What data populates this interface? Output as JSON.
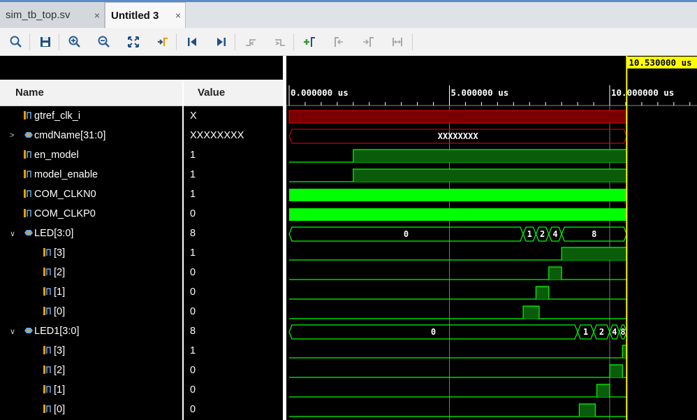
{
  "tabs": [
    {
      "label": "sim_tb_top.sv",
      "close": "×",
      "active": false
    },
    {
      "label": "Untitled 3",
      "close": "×",
      "active": true
    }
  ],
  "toolbar": [
    {
      "name": "search-icon"
    },
    {
      "name": "save-icon"
    },
    {
      "name": "zoom-in-icon"
    },
    {
      "name": "zoom-out-icon"
    },
    {
      "name": "zoom-fit-icon"
    },
    {
      "name": "go-to-cursor-icon"
    },
    {
      "name": "go-to-time-zero-icon"
    },
    {
      "name": "go-to-last-time-icon"
    },
    {
      "name": "previous-transition-icon"
    },
    {
      "name": "next-transition-icon"
    },
    {
      "name": "add-marker-icon"
    },
    {
      "name": "previous-marker-icon"
    },
    {
      "name": "next-marker-icon"
    },
    {
      "name": "swap-cursors-icon"
    }
  ],
  "columns": {
    "name": "Name",
    "value": "Value"
  },
  "signals": [
    {
      "name": "gtref_clk_i",
      "value": "X",
      "kind": "bit",
      "expander": "",
      "indent": 0
    },
    {
      "name": "cmdName[31:0]",
      "value": "XXXXXXXX",
      "kind": "bus",
      "expander": ">",
      "indent": 0
    },
    {
      "name": "en_model",
      "value": "1",
      "kind": "bit",
      "expander": "",
      "indent": 0
    },
    {
      "name": "model_enable",
      "value": "1",
      "kind": "bit",
      "expander": "",
      "indent": 0
    },
    {
      "name": "COM_CLKN0",
      "value": "1",
      "kind": "bit",
      "expander": "",
      "indent": 0
    },
    {
      "name": "COM_CLKP0",
      "value": "0",
      "kind": "bit",
      "expander": "",
      "indent": 0
    },
    {
      "name": "LED[3:0]",
      "value": "8",
      "kind": "bus",
      "expander": "∨",
      "indent": 0
    },
    {
      "name": "[3]",
      "value": "1",
      "kind": "bit",
      "expander": "",
      "indent": 1
    },
    {
      "name": "[2]",
      "value": "0",
      "kind": "bit",
      "expander": "",
      "indent": 1
    },
    {
      "name": "[1]",
      "value": "0",
      "kind": "bit",
      "expander": "",
      "indent": 1
    },
    {
      "name": "[0]",
      "value": "0",
      "kind": "bit",
      "expander": "",
      "indent": 1
    },
    {
      "name": "LED1[3:0]",
      "value": "8",
      "kind": "bus",
      "expander": "∨",
      "indent": 0
    },
    {
      "name": "[3]",
      "value": "1",
      "kind": "bit",
      "expander": "",
      "indent": 1
    },
    {
      "name": "[2]",
      "value": "0",
      "kind": "bit",
      "expander": "",
      "indent": 1
    },
    {
      "name": "[1]",
      "value": "0",
      "kind": "bit",
      "expander": "",
      "indent": 1
    },
    {
      "name": "[0]",
      "value": "0",
      "kind": "bit",
      "expander": "",
      "indent": 1
    }
  ],
  "timeline": {
    "unit": "us",
    "tick_labels": [
      "0.000000 us",
      "5.000000 us",
      "10.000000 us"
    ],
    "cursor_label": "10.530000 us",
    "cursor_time": 10.53,
    "colors": {
      "high": "#00ff00",
      "fill": "#0a5c0a",
      "x": "#cc0000",
      "x_fill": "#7a0000",
      "cursor": "#ffff00"
    }
  },
  "waves": {
    "cmdName": [
      {
        "start": 0,
        "end": 10.53,
        "label": "XXXXXXXX"
      }
    ],
    "en_model": {
      "rise": 2.0
    },
    "model_enable": {
      "rise": 2.0
    },
    "LED": [
      {
        "start": 0,
        "end": 7.3,
        "label": "0"
      },
      {
        "start": 7.3,
        "end": 7.7,
        "label": "1"
      },
      {
        "start": 7.7,
        "end": 8.1,
        "label": "2"
      },
      {
        "start": 8.1,
        "end": 8.5,
        "label": "4"
      },
      {
        "start": 8.5,
        "end": 10.53,
        "label": "8"
      }
    ],
    "LED_bits": {
      "3": [
        [
          8.5,
          10.53
        ]
      ],
      "2": [
        [
          8.1,
          8.5
        ]
      ],
      "1": [
        [
          7.7,
          8.1
        ]
      ],
      "0": [
        [
          7.3,
          7.8
        ]
      ]
    },
    "LED1": [
      {
        "start": 0,
        "end": 9.0,
        "label": "0"
      },
      {
        "start": 9.0,
        "end": 9.5,
        "label": "1"
      },
      {
        "start": 9.5,
        "end": 10.0,
        "label": "2"
      },
      {
        "start": 10.0,
        "end": 10.3,
        "label": "4"
      },
      {
        "start": 10.3,
        "end": 10.53,
        "label": "8"
      }
    ],
    "LED1_bits": {
      "3": [
        [
          10.4,
          10.53
        ]
      ],
      "2": [
        [
          10.0,
          10.4
        ]
      ],
      "1": [
        [
          9.6,
          10.0
        ]
      ],
      "0": [
        [
          9.05,
          9.55
        ]
      ]
    }
  }
}
